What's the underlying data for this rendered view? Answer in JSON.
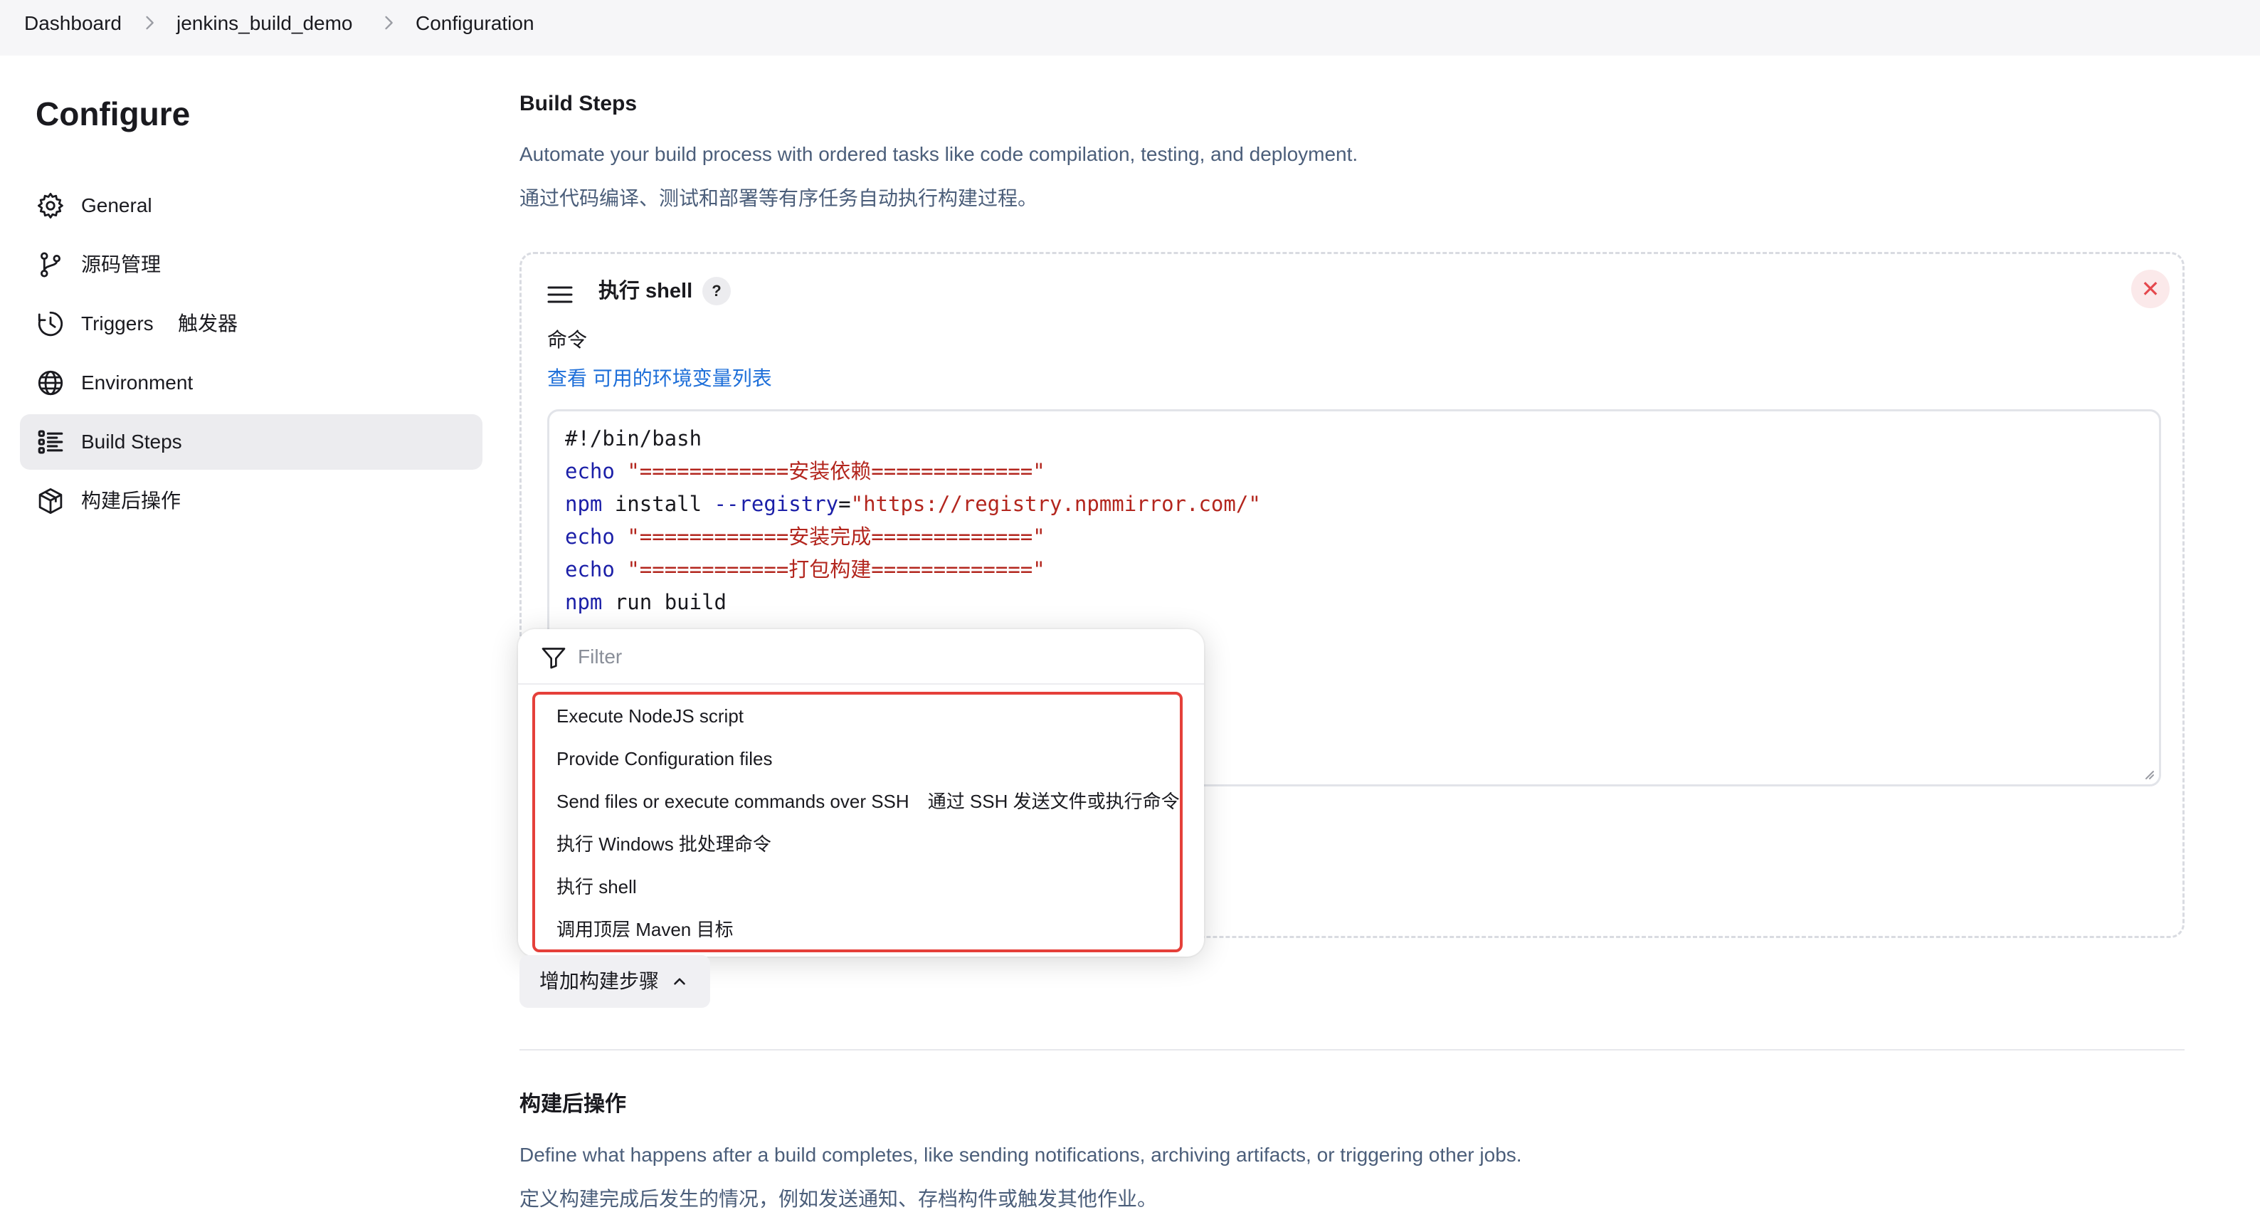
{
  "breadcrumb": {
    "items": [
      "Dashboard",
      "jenkins_build_demo",
      "Configuration"
    ]
  },
  "sidebar": {
    "title": "Configure",
    "items": [
      {
        "label": "General",
        "icon": "gear-icon"
      },
      {
        "label": "源码管理",
        "icon": "git-branch-icon"
      },
      {
        "label": "Triggers",
        "label_cn": "触发器",
        "icon": "clock-icon"
      },
      {
        "label": "Environment",
        "icon": "globe-icon"
      },
      {
        "label": "Build Steps",
        "icon": "list-icon",
        "active": true
      },
      {
        "label": "构建后操作",
        "icon": "package-icon"
      }
    ]
  },
  "build_steps": {
    "title": "Build Steps",
    "desc_en": "Automate your build process with ordered tasks like code compilation, testing, and deployment.",
    "desc_cn": "通过代码编译、测试和部署等有序任务自动执行构建过程。",
    "step": {
      "title": "执行 shell",
      "help": "?",
      "delete": "✕",
      "command_label": "命令",
      "env_prefix": "查看 ",
      "env_link": "可用的环境变量列表",
      "code": [
        {
          "tokens": [
            {
              "t": "#!/bin/bash",
              "c": ""
            }
          ]
        },
        {
          "tokens": [
            {
              "t": "echo",
              "c": "kw"
            },
            {
              "t": " ",
              "c": ""
            },
            {
              "t": "\"============安装依赖=============\"",
              "c": "str"
            }
          ]
        },
        {
          "tokens": [
            {
              "t": "npm",
              "c": "kw"
            },
            {
              "t": " install ",
              "c": ""
            },
            {
              "t": "--registry",
              "c": "kw"
            },
            {
              "t": "=",
              "c": ""
            },
            {
              "t": "\"https://registry.npmmirror.com/\"",
              "c": "str"
            }
          ]
        },
        {
          "tokens": [
            {
              "t": "echo",
              "c": "kw"
            },
            {
              "t": " ",
              "c": ""
            },
            {
              "t": "\"============安装完成=============\"",
              "c": "str"
            }
          ]
        },
        {
          "tokens": [
            {
              "t": "echo",
              "c": "kw"
            },
            {
              "t": " ",
              "c": ""
            },
            {
              "t": "\"============打包构建=============\"",
              "c": "str"
            }
          ]
        },
        {
          "tokens": [
            {
              "t": "npm",
              "c": "kw"
            },
            {
              "t": " run build",
              "c": ""
            }
          ]
        }
      ]
    },
    "add_step_label": "增加构建步骤"
  },
  "dropdown": {
    "filter_placeholder": "Filter",
    "items": [
      {
        "label": "Execute NodeJS script",
        "note": ""
      },
      {
        "label": "Provide Configuration files",
        "note": ""
      },
      {
        "label": "Send files or execute commands over SSH",
        "note": "通过 SSH 发送文件或执行命令"
      },
      {
        "label": "执行 Windows 批处理命令",
        "note": ""
      },
      {
        "label": "执行 shell",
        "note": ""
      },
      {
        "label": "调用顶层 Maven 目标",
        "note": ""
      }
    ]
  },
  "post_build": {
    "title": "构建后操作",
    "desc_en": "Define what happens after a build completes, like sending notifications, archiving artifacts, or triggering other jobs.",
    "desc_cn": "定义构建完成后发生的情况，例如发送通知、存档构件或触发其他作业。"
  },
  "colors": {
    "link": "#1e6fd9",
    "highlight_border": "#e5403a",
    "delete": "#e5484d",
    "keyword": "#1b1fa8",
    "string": "#b3261e"
  }
}
